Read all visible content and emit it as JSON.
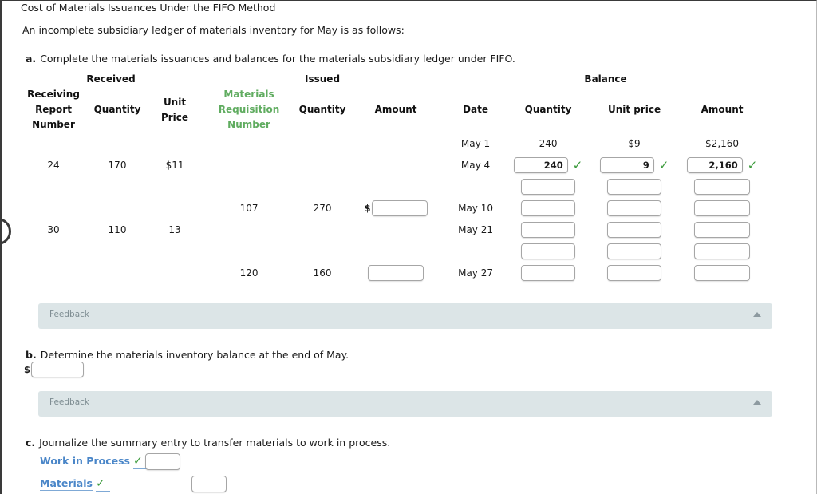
{
  "page": {
    "title": "Cost of Materials Issuances Under the FIFO Method",
    "intro": "An incomplete subsidiary ledger of materials inventory for May is as follows:"
  },
  "questions": {
    "a": {
      "letter": "a.",
      "text": "Complete the materials issuances and balances for the materials subsidiary ledger under FIFO."
    },
    "b": {
      "letter": "b.",
      "text": "Determine the materials inventory balance at the end of May.",
      "currency_symbol": "$",
      "input_value": ""
    },
    "c": {
      "letter": "c.",
      "text": "Journalize the summary entry to transfer materials to work in process."
    }
  },
  "ledger": {
    "groups": [
      {
        "label": "Received"
      },
      {
        "label": "Issued"
      },
      {
        "label": "Balance"
      }
    ],
    "columns": {
      "received": [
        {
          "label": "Receiving Report Number",
          "color": "#111111"
        },
        {
          "label": "Quantity",
          "color": "#111111"
        },
        {
          "label": "Unit Price",
          "color": "#111111"
        }
      ],
      "issued": [
        {
          "label": "Materials Requisition Number",
          "color": "#60ac60"
        },
        {
          "label": "Quantity",
          "color": "#111111"
        },
        {
          "label": "Amount",
          "color": "#111111"
        }
      ],
      "balance": [
        {
          "label": "Date",
          "color": "#111111"
        },
        {
          "label": "Quantity",
          "color": "#111111"
        },
        {
          "label": "Unit price",
          "color": "#111111"
        },
        {
          "label": "Amount",
          "color": "#111111"
        }
      ]
    },
    "rows": [
      {
        "received": {
          "report": "",
          "quantity": "",
          "unit_price": ""
        },
        "issued": {
          "requisition": "",
          "quantity": "",
          "amount_prefix": "",
          "amount_value": null
        },
        "balance": {
          "date": "May 1",
          "quantity": "240",
          "unit_price": "$9",
          "amount": "$2,160",
          "static": true
        }
      },
      {
        "received": {
          "report": "24",
          "quantity": "170",
          "unit_price": "$11"
        },
        "issued": {
          "requisition": "",
          "quantity": "",
          "amount_prefix": "",
          "amount_value": null
        },
        "balance": {
          "date": "May 4",
          "quantity": "240",
          "unit_price": "9",
          "amount": "2,160",
          "static": false,
          "checked": true
        }
      },
      {
        "received": {
          "report": "",
          "quantity": "",
          "unit_price": ""
        },
        "issued": {
          "requisition": "",
          "quantity": "",
          "amount_prefix": "",
          "amount_value": null
        },
        "balance": {
          "date": "",
          "quantity": "",
          "unit_price": "",
          "amount": "",
          "static": false,
          "checked": false
        }
      },
      {
        "received": {
          "report": "",
          "quantity": "",
          "unit_price": ""
        },
        "issued": {
          "requisition": "107",
          "quantity": "270",
          "amount_prefix": "$",
          "amount_value": ""
        },
        "balance": {
          "date": "May 10",
          "quantity": "",
          "unit_price": "",
          "amount": "",
          "static": false,
          "checked": false
        }
      },
      {
        "received": {
          "report": "30",
          "quantity": "110",
          "unit_price": "13"
        },
        "issued": {
          "requisition": "",
          "quantity": "",
          "amount_prefix": "",
          "amount_value": null
        },
        "balance": {
          "date": "May 21",
          "quantity": "",
          "unit_price": "",
          "amount": "",
          "static": false,
          "checked": false
        }
      },
      {
        "received": {
          "report": "",
          "quantity": "",
          "unit_price": ""
        },
        "issued": {
          "requisition": "",
          "quantity": "",
          "amount_prefix": "",
          "amount_value": null
        },
        "balance": {
          "date": "",
          "quantity": "",
          "unit_price": "",
          "amount": "",
          "static": false,
          "checked": false
        }
      },
      {
        "received": {
          "report": "",
          "quantity": "",
          "unit_price": ""
        },
        "issued": {
          "requisition": "120",
          "quantity": "160",
          "amount_prefix": "",
          "amount_value": ""
        },
        "balance": {
          "date": "May 27",
          "quantity": "",
          "unit_price": "",
          "amount": "",
          "static": false,
          "checked": false
        }
      }
    ]
  },
  "feedback": [
    {
      "label": "Feedback",
      "toggle_icon": "triangle-up-icon"
    },
    {
      "label": "Feedback",
      "toggle_icon": "triangle-up-icon"
    }
  ],
  "journal": {
    "entries": [
      {
        "account": "Work in Process",
        "checked": true,
        "check_glyph": "✓",
        "debit": "",
        "credit": null
      },
      {
        "account": "Materials",
        "checked": true,
        "check_glyph": "✓",
        "debit": null,
        "credit": ""
      }
    ]
  },
  "colors": {
    "green_header": "#60ac60",
    "green_check": "#3a9a3a",
    "link_blue": "#4a86c8",
    "feedback_bg": "#dce5e7",
    "feedback_text": "#7d8c91"
  }
}
